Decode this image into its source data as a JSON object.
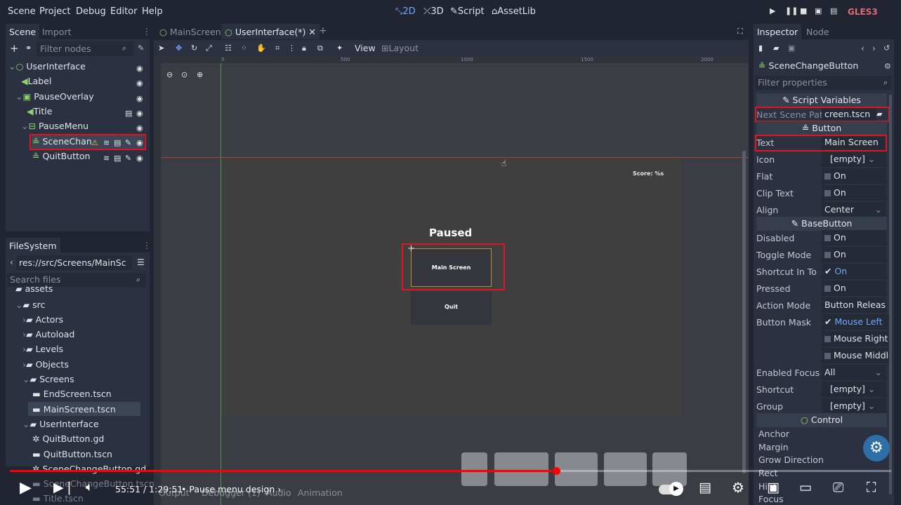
{
  "menubar": {
    "menus": [
      "Scene",
      "Project",
      "Debug",
      "Editor",
      "Help"
    ],
    "workspaces": [
      "2D",
      "3D",
      "Script",
      "AssetLib"
    ],
    "renderer": "GLES3"
  },
  "scene_panel": {
    "tabs": [
      "Scene",
      "Import"
    ],
    "filter_placeholder": "Filter nodes",
    "nodes": [
      "UserInterface",
      "Label",
      "PauseOverlay",
      "Title",
      "PauseMenu",
      "SceneChan",
      "QuitButton"
    ]
  },
  "filesystem": {
    "tab": "FileSystem",
    "path": "res://src/Screens/MainSc",
    "search_placeholder": "Search files",
    "items": [
      "assets",
      "src",
      "Actors",
      "Autoload",
      "Levels",
      "Objects",
      "Screens",
      "EndScreen.tscn",
      "MainScreen.tscn",
      "UserInterface",
      "QuitButton.gd",
      "QuitButton.tscn",
      "SceneChangeButton.gd",
      "SceneChangeButton.tscn",
      "Title.tscn"
    ]
  },
  "editor_tabs": [
    "MainScreen",
    "UserInterface(*)"
  ],
  "toolbar": {
    "view": "View",
    "layout": "Layout"
  },
  "ruler": [
    "0",
    "500",
    "1000",
    "1500",
    "2000"
  ],
  "canvas": {
    "score": "Score: %s",
    "paused": "Paused",
    "main_button": "Main Screen",
    "quit_button": "Quit"
  },
  "inspector": {
    "tabs": [
      "Inspector",
      "Node"
    ],
    "node_name": "SceneChangeButton",
    "filter_placeholder": "Filter properties",
    "sections": {
      "script_vars": "Script Variables",
      "button": "Button",
      "base_button": "BaseButton",
      "control": "Control"
    },
    "props": [
      {
        "label": "Next Scene Pat",
        "value": "creen.tscn"
      },
      {
        "label": "Text",
        "value": "Main Screen"
      },
      {
        "label": "Icon",
        "value": "[empty]"
      },
      {
        "label": "Flat",
        "value": "On"
      },
      {
        "label": "Clip Text",
        "value": "On"
      },
      {
        "label": "Align",
        "value": "Center"
      },
      {
        "label": "Disabled",
        "value": "On"
      },
      {
        "label": "Toggle Mode",
        "value": "On"
      },
      {
        "label": "Shortcut In To",
        "value": "On"
      },
      {
        "label": "Pressed",
        "value": "On"
      },
      {
        "label": "Action Mode",
        "value": "Button Releas"
      },
      {
        "label": "Button Mask",
        "value": "Mouse Left"
      },
      {
        "label": "",
        "value": "Mouse Right"
      },
      {
        "label": "",
        "value": "Mouse Middle"
      },
      {
        "label": "Enabled Focus",
        "value": "All"
      },
      {
        "label": "Shortcut",
        "value": "[empty]"
      },
      {
        "label": "Group",
        "value": "[empty]"
      }
    ],
    "control_rows": [
      "Anchor",
      "Margin",
      "Grow Direction",
      "Rect",
      "Hint",
      "Focus"
    ]
  },
  "bottom_tabs": [
    "Output",
    "Debugger (1)",
    "Audio",
    "Animation"
  ],
  "video": {
    "time": "55:51 / 1:29:51",
    "chapter": "Pause menu design",
    "progress": 0.62
  },
  "colors": {
    "accent": "#6ea8ff",
    "highlight": "#e2141e",
    "progress": "#ff0000"
  }
}
